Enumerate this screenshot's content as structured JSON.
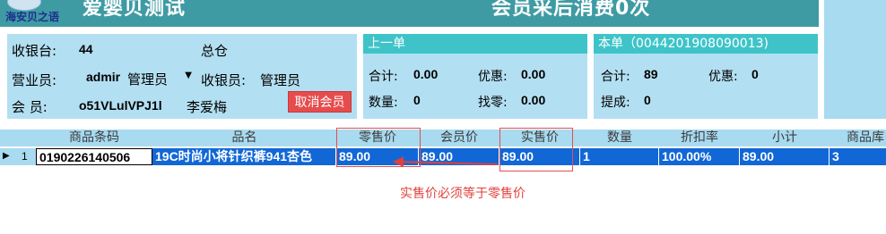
{
  "header": {
    "logo_text": "海安贝之语",
    "title": "爱婴贝测试",
    "subtitle": "会员采后消费0次"
  },
  "info_panel": {
    "register_label": "收银台:",
    "register_value": "44",
    "warehouse": "总仓",
    "salesperson_label": "营业员:",
    "salesperson_value": "admir",
    "salesperson_role": "管理员",
    "cashier_label": "收银员:",
    "cashier_value": "管理员",
    "member_label": "会  员:",
    "member_id": "o51VLulVPJ1l",
    "member_name": "李爱梅",
    "cancel_member_button": "取消会员"
  },
  "prev_panel": {
    "title": "上一单",
    "total_label": "合计:",
    "total_value": "0.00",
    "discount_label": "优惠:",
    "discount_value": "0.00",
    "qty_label": "数量:",
    "qty_value": "0",
    "change_label": "找零:",
    "change_value": "0.00"
  },
  "current_panel": {
    "title": "本单（0044201908090013)",
    "total_label": "合计:",
    "total_value": "89",
    "discount_label": "优惠:",
    "discount_value": "0",
    "commission_label": "提成:",
    "commission_value": "0"
  },
  "grid": {
    "columns": [
      "商品条码",
      "品名",
      "零售价",
      "会员价",
      "实售价",
      "数量",
      "折扣率",
      "小计",
      "商品库"
    ],
    "rows": [
      {
        "row_marker": "▶",
        "row_num": "1",
        "barcode": "0190226140506",
        "name": "19C时尚小将针织裤941杏色",
        "retail_price": "89.00",
        "member_price": "89.00",
        "actual_price": "89.00",
        "quantity": "1",
        "discount_rate": "100.00%",
        "subtotal": "89.00",
        "stock": "3"
      }
    ]
  },
  "annotation": {
    "text": "实售价必须等于零售价",
    "color": "#e0403c"
  }
}
